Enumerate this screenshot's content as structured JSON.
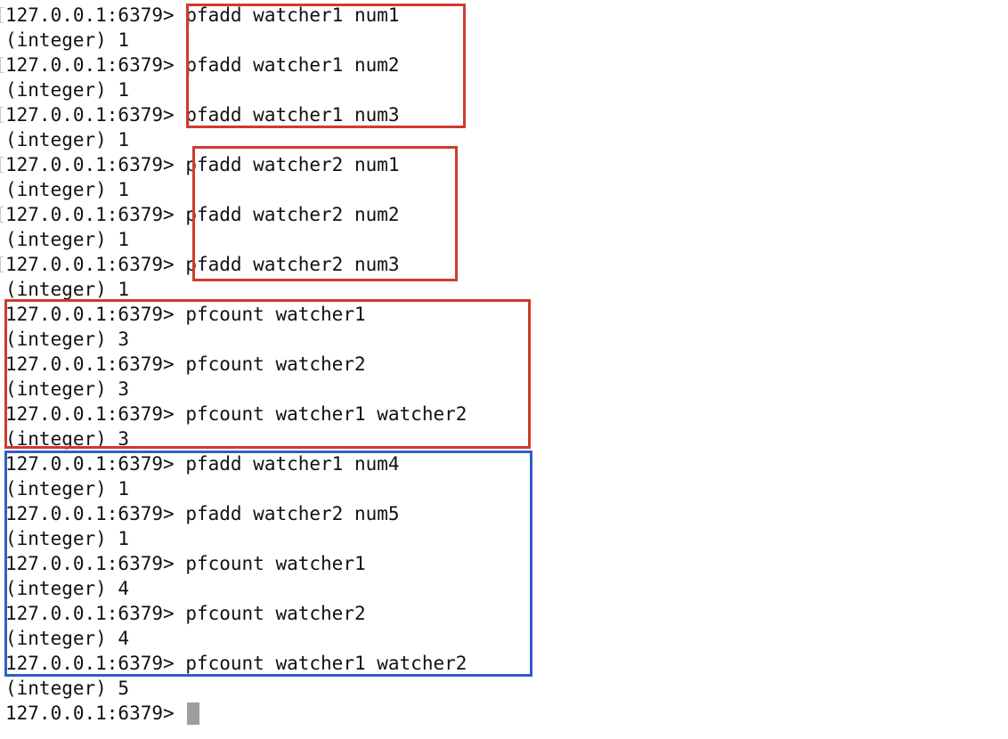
{
  "terminal": {
    "prompt": "127.0.0.1:6379>",
    "lines": [
      {
        "kind": "cmd",
        "command": "pfadd watcher1 num1",
        "marker": true
      },
      {
        "kind": "out",
        "text": "(integer) 1"
      },
      {
        "kind": "cmd",
        "command": "pfadd watcher1 num2",
        "marker": true
      },
      {
        "kind": "out",
        "text": "(integer) 1"
      },
      {
        "kind": "cmd",
        "command": "pfadd watcher1 num3",
        "marker": true
      },
      {
        "kind": "out",
        "text": "(integer) 1"
      },
      {
        "kind": "cmd",
        "command": "pfadd watcher2 num1",
        "marker": true
      },
      {
        "kind": "out",
        "text": "(integer) 1"
      },
      {
        "kind": "cmd",
        "command": "pfadd watcher2 num2",
        "marker": true
      },
      {
        "kind": "out",
        "text": "(integer) 1"
      },
      {
        "kind": "cmd",
        "command": "pfadd watcher2 num3",
        "marker": true
      },
      {
        "kind": "out",
        "text": "(integer) 1"
      },
      {
        "kind": "cmd",
        "command": "pfcount watcher1"
      },
      {
        "kind": "out",
        "text": "(integer) 3"
      },
      {
        "kind": "cmd",
        "command": "pfcount watcher2"
      },
      {
        "kind": "out",
        "text": "(integer) 3"
      },
      {
        "kind": "cmd",
        "command": "pfcount watcher1 watcher2"
      },
      {
        "kind": "out",
        "text": "(integer) 3"
      },
      {
        "kind": "cmd",
        "command": "pfadd watcher1 num4"
      },
      {
        "kind": "out",
        "text": "(integer) 1"
      },
      {
        "kind": "cmd",
        "command": "pfadd watcher2 num5"
      },
      {
        "kind": "out",
        "text": "(integer) 1"
      },
      {
        "kind": "cmd",
        "command": "pfcount watcher1"
      },
      {
        "kind": "out",
        "text": "(integer) 4"
      },
      {
        "kind": "cmd",
        "command": "pfcount watcher2"
      },
      {
        "kind": "out",
        "text": "(integer) 4"
      },
      {
        "kind": "cmd",
        "command": "pfcount watcher1 watcher2"
      },
      {
        "kind": "out",
        "text": "(integer) 5"
      },
      {
        "kind": "cmd",
        "command": "",
        "cursor": true
      }
    ]
  },
  "colors": {
    "background": "#ffffff",
    "text": "#111111",
    "highlight_red": "#cf3b2f",
    "highlight_blue": "#2f5fc8",
    "cursor": "#9e9e9e"
  }
}
